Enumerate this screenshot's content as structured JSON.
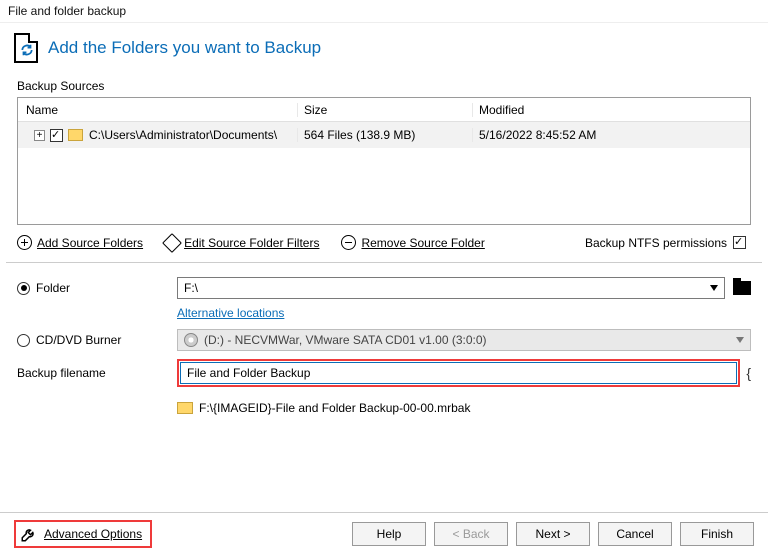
{
  "window_title": "File and folder backup",
  "header": {
    "title": "Add the Folders you want to Backup"
  },
  "backup_sources": {
    "label": "Backup Sources",
    "columns": {
      "name": "Name",
      "size": "Size",
      "modified": "Modified"
    },
    "rows": [
      {
        "checked": true,
        "path": "C:\\Users\\Administrator\\Documents\\",
        "size": "564 Files (138.9 MB)",
        "modified": "5/16/2022 8:45:52 AM"
      }
    ]
  },
  "actions": {
    "add": "Add Source Folders",
    "edit": "Edit Source Folder Filters",
    "remove": "Remove Source Folder",
    "ntfs_label": "Backup NTFS permissions",
    "ntfs_checked": true
  },
  "destination": {
    "folder_label": "Folder",
    "folder_value": "F:\\",
    "alt_locations": "Alternative locations",
    "cd_label": "CD/DVD Burner",
    "cd_value": "(D:) - NECVMWar, VMware SATA CD01 v1.00 (3:0:0)",
    "filename_label": "Backup filename",
    "filename_value": "File and Folder Backup",
    "target_preview": "F:\\{IMAGEID}-File and Folder Backup-00-00.mrbak",
    "selected": "folder"
  },
  "footer": {
    "advanced": "Advanced Options",
    "help": "Help",
    "back": "< Back",
    "next": "Next >",
    "cancel": "Cancel",
    "finish": "Finish"
  }
}
